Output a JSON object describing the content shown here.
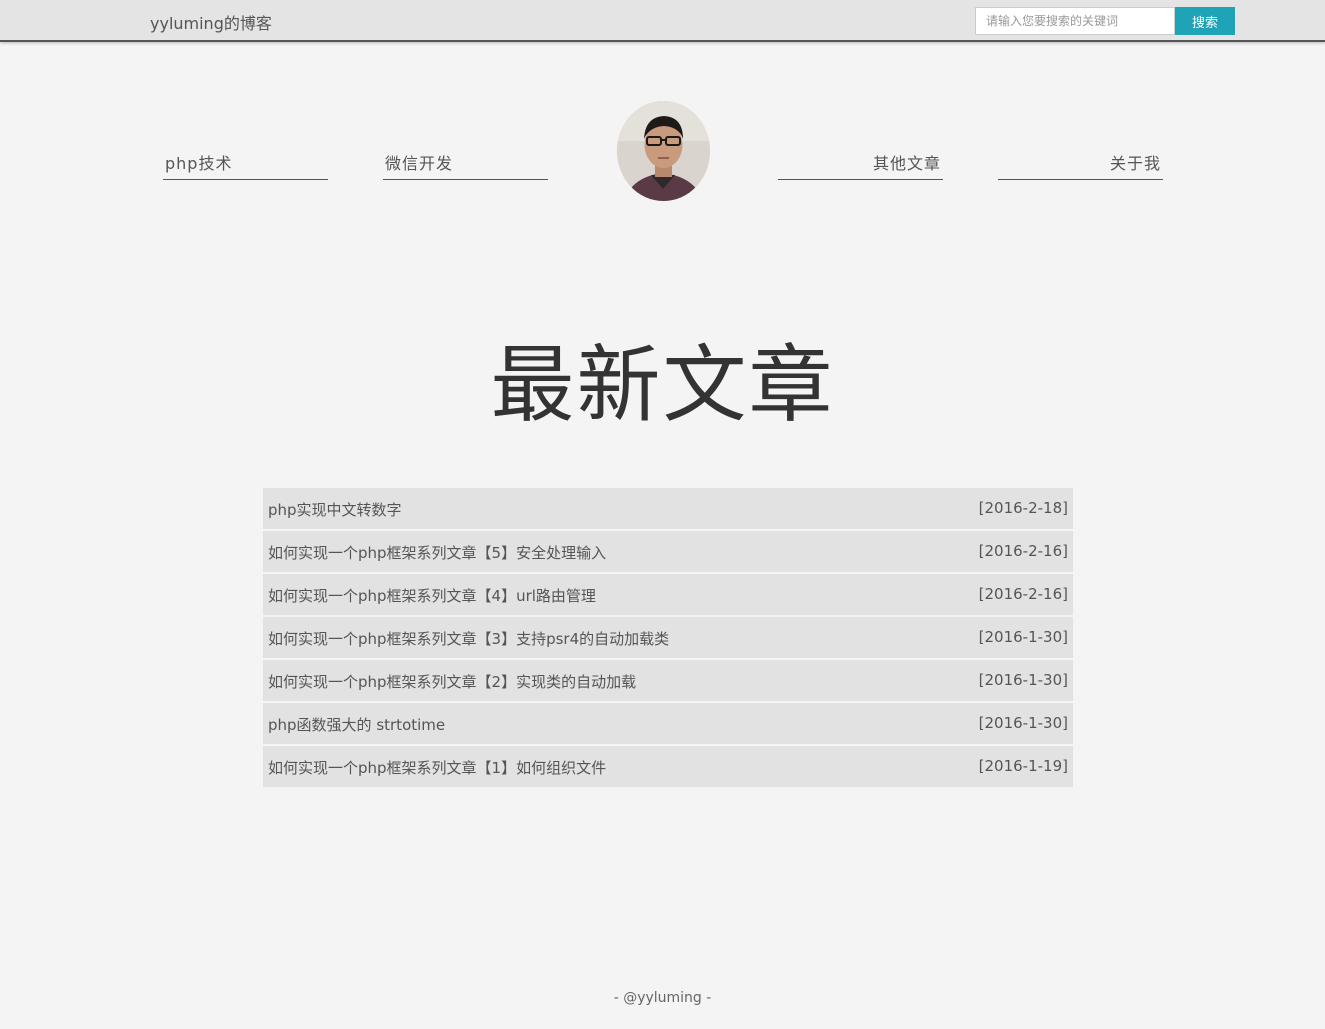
{
  "header": {
    "brand": "yyluming的博客",
    "search_placeholder": "请输入您要搜索的关键词",
    "search_button": "搜索",
    "accent_color": "#1fa3b6"
  },
  "nav": {
    "items": [
      {
        "label": "php技术"
      },
      {
        "label": "微信开发"
      },
      {
        "label": "其他文章"
      },
      {
        "label": "关于我"
      }
    ]
  },
  "main": {
    "heading": "最新文章",
    "articles": [
      {
        "title": "php实现中文转数字",
        "date": "[2016-2-18]"
      },
      {
        "title": "如何实现一个php框架系列文章【5】安全处理输入",
        "date": "[2016-2-16]"
      },
      {
        "title": "如何实现一个php框架系列文章【4】url路由管理",
        "date": "[2016-2-16]"
      },
      {
        "title": "如何实现一个php框架系列文章【3】支持psr4的自动加载类",
        "date": "[2016-1-30]"
      },
      {
        "title": "如何实现一个php框架系列文章【2】实现类的自动加载",
        "date": "[2016-1-30]"
      },
      {
        "title": "php函数强大的 strtotime",
        "date": "[2016-1-30]"
      },
      {
        "title": "如何实现一个php框架系列文章【1】如何组织文件",
        "date": "[2016-1-19]"
      }
    ]
  },
  "footer": {
    "text": "- @yyluming -"
  }
}
